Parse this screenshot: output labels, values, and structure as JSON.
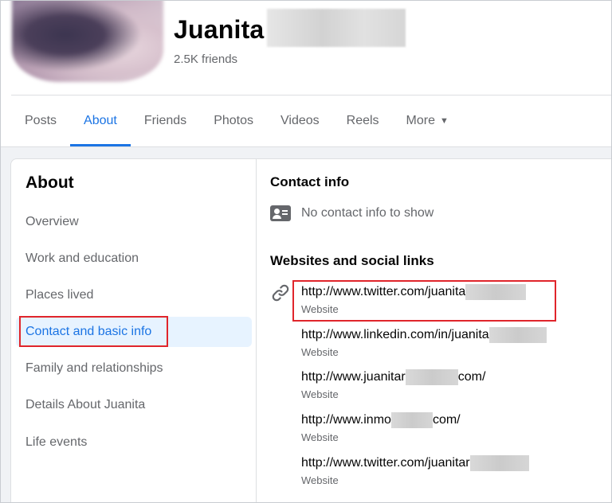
{
  "profile": {
    "name": "Juanita",
    "friends": "2.5K friends"
  },
  "tabs": [
    {
      "label": "Posts"
    },
    {
      "label": "About",
      "active": true
    },
    {
      "label": "Friends"
    },
    {
      "label": "Photos"
    },
    {
      "label": "Videos"
    },
    {
      "label": "Reels"
    },
    {
      "label": "More"
    }
  ],
  "sidebar": {
    "title": "About",
    "items": [
      {
        "label": "Overview"
      },
      {
        "label": "Work and education"
      },
      {
        "label": "Places lived"
      },
      {
        "label": "Contact and basic info",
        "active": true
      },
      {
        "label": "Family and relationships"
      },
      {
        "label": "Details About Juanita"
      },
      {
        "label": "Life events"
      }
    ]
  },
  "contact": {
    "title": "Contact info",
    "empty_text": "No contact info to show",
    "icon": "contact-card-icon"
  },
  "websites": {
    "title": "Websites and social links",
    "icon": "link-icon",
    "items": [
      {
        "url_prefix": "http://www.twitter.com/juanita",
        "url_suffix": "",
        "type": "Website"
      },
      {
        "url_prefix": "http://www.linkedin.com/in/juanita",
        "url_suffix": "",
        "type": "Website"
      },
      {
        "url_prefix": "http://www.juanitar",
        "url_suffix": "com/",
        "type": "Website"
      },
      {
        "url_prefix": "http://www.inmo",
        "url_suffix": "com/",
        "type": "Website"
      },
      {
        "url_prefix": "http://www.twitter.com/juanitar",
        "url_suffix": "",
        "type": "Website"
      }
    ]
  },
  "colors": {
    "accent": "#1b74e4",
    "highlight": "#e0252b"
  }
}
